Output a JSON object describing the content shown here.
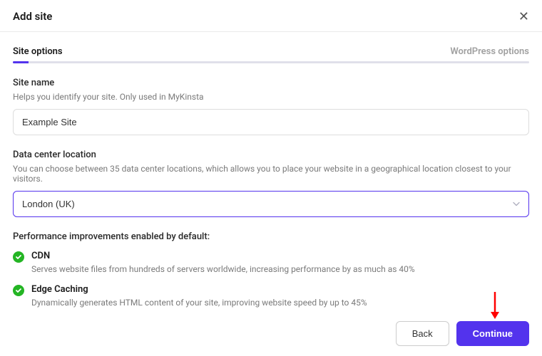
{
  "header": {
    "title": "Add site"
  },
  "steps": {
    "current": "Site options",
    "next": "WordPress options"
  },
  "siteName": {
    "label": "Site name",
    "help": "Helps you identify your site. Only used in MyKinsta",
    "value": "Example Site"
  },
  "dataCenter": {
    "label": "Data center location",
    "help": "You can choose between 35 data center locations, which allows you to place your website in a geographical location closest to your visitors.",
    "value": "London (UK)"
  },
  "performance": {
    "title": "Performance improvements enabled by default:",
    "items": [
      {
        "name": "CDN",
        "desc": "Serves website files from hundreds of servers worldwide, increasing performance by as much as 40%"
      },
      {
        "name": "Edge Caching",
        "desc": "Dynamically generates HTML content of your site, improving website speed by up to 45%"
      }
    ]
  },
  "footer": {
    "back": "Back",
    "continue": "Continue"
  }
}
